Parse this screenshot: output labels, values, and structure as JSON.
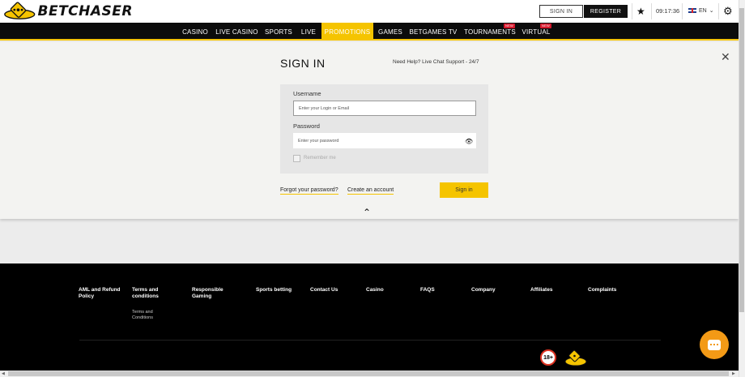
{
  "header": {
    "logo_text": "BETCHASER",
    "sign_in_label": "SIGN IN",
    "register_label": "REGISTER",
    "time": "09:17:36",
    "language": "EN"
  },
  "nav": {
    "items": [
      {
        "label": "CASINO"
      },
      {
        "label": "LIVE CASINO"
      },
      {
        "label": "SPORTS"
      },
      {
        "label": "LIVE"
      },
      {
        "label": "PROMOTIONS",
        "active": true
      },
      {
        "label": "GAMES"
      },
      {
        "label": "BETGAMES TV"
      },
      {
        "label": "TOURNAMENTS",
        "badge": "NEW"
      },
      {
        "label": "VIRTUAL",
        "badge": "NEW"
      }
    ]
  },
  "signin": {
    "title": "SIGN IN",
    "help_text": "Need Help? Live Chat Support - 24/7",
    "username_label": "Username",
    "username_placeholder": "Enter your Login or Email",
    "password_label": "Password",
    "password_placeholder": "Enter your password",
    "remember_label": "Remember me",
    "forgot_link": "Forgot your password?",
    "create_link": "Create an account",
    "submit_label": "Sign in"
  },
  "footer": {
    "columns": [
      {
        "title": "AML and Refund Policy"
      },
      {
        "title": "Terms and conditions",
        "sub": "Terms and Conditions"
      },
      {
        "title": "Responsible Gaming"
      },
      {
        "title": "Sports betting"
      },
      {
        "title": "Contact Us"
      },
      {
        "title": "Casino"
      },
      {
        "title": "FAQS"
      },
      {
        "title": "Company"
      },
      {
        "title": "Affiliates"
      },
      {
        "title": "Complaints"
      }
    ],
    "age_badge": "18+"
  },
  "colors": {
    "accent": "#f5c400",
    "nav_bg": "#0c0c0c",
    "footer_bg": "#000000",
    "chat_button": "#f39a16",
    "badge_new": "#d6182c"
  }
}
